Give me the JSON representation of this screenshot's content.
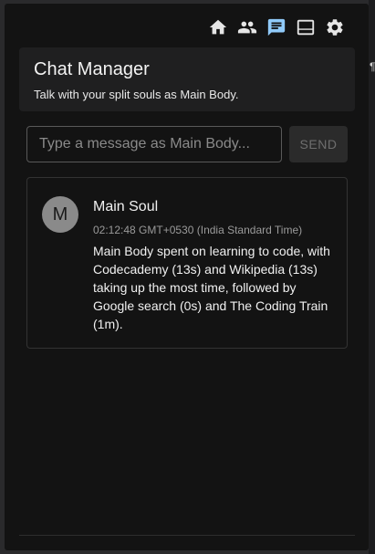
{
  "toolbar": {
    "icons": [
      "home-icon",
      "people-icon",
      "chat-icon",
      "panel-icon",
      "settings-icon"
    ],
    "active": "chat-icon",
    "active_color": "#90caf9"
  },
  "header": {
    "title": "Chat Manager",
    "subtitle": "Talk with your split souls as Main Body."
  },
  "composer": {
    "placeholder": "Type a message as Main Body...",
    "value": "",
    "send_label": "SEND"
  },
  "messages": [
    {
      "avatar_letter": "M",
      "author": "Main Soul",
      "time": "02:12:48 GMT+0530 (India Standard Time)",
      "text": "Main Body spent on learning to code, with Codecademy (13s) and Wikipedia (13s) taking up the most time, followed by Google search (0s) and The Coding Train (1m)."
    }
  ],
  "edge_glyph": "¶"
}
